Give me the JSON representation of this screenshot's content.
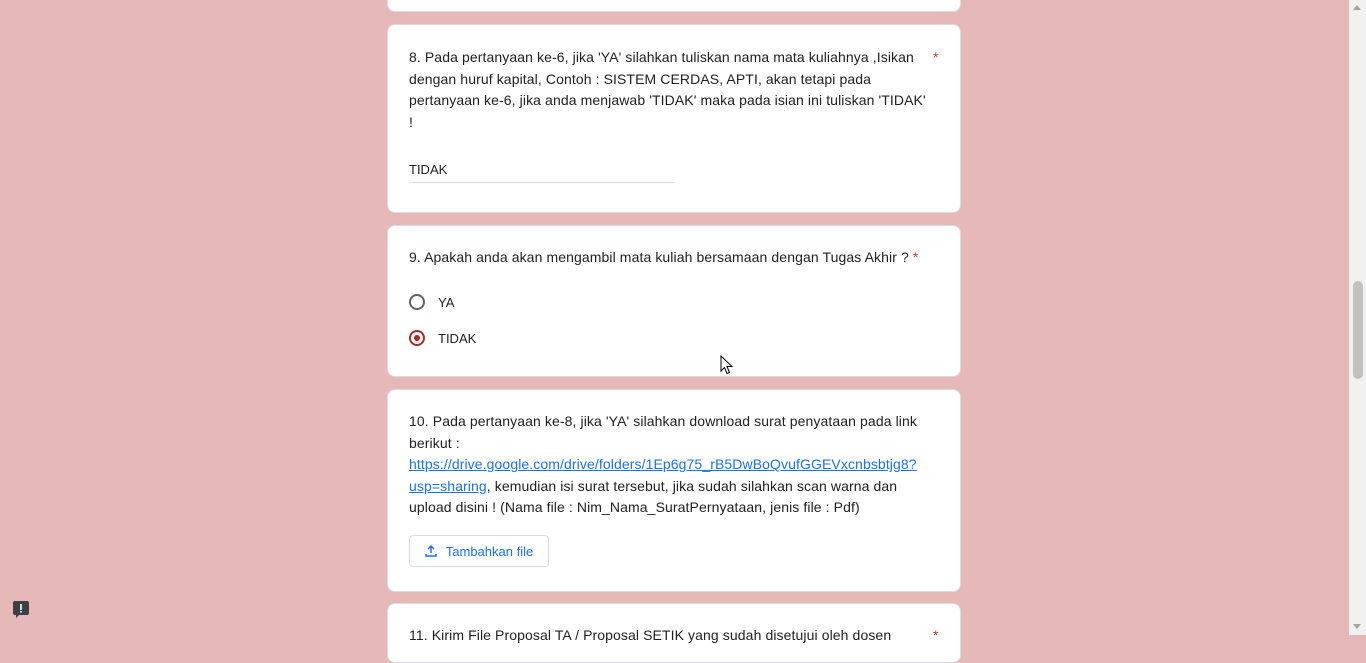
{
  "colors": {
    "background": "#e6b8b8",
    "accent": "#b3261e",
    "link": "#1a73e8",
    "required": "#d93025"
  },
  "questions": {
    "q8": {
      "text": "8. Pada pertanyaan ke-6, jika 'YA' silahkan tuliskan nama mata kuliahnya ,Isikan dengan huruf kapital, Contoh : SISTEM CERDAS, APTI, akan tetapi pada pertanyaan ke-6, jika anda menjawab 'TIDAK' maka pada isian ini tuliskan 'TIDAK' !",
      "required_mark": "*",
      "answer": "TIDAK"
    },
    "q9": {
      "text": "9. Apakah anda akan mengambil mata kuliah bersamaan dengan Tugas Akhir ?",
      "required_mark": "*",
      "options": [
        "YA",
        "TIDAK"
      ],
      "selected": "TIDAK"
    },
    "q10": {
      "text_before": "10. Pada pertanyaan ke-8, jika 'YA' silahkan download  surat penyataan pada link berikut : ",
      "link": "https://drive.google.com/drive/folders/1Ep6g75_rB5DwBoQvufGGEVxcnbsbtjg8?usp=sharing",
      "text_after": ", kemudian isi surat tersebut, jika sudah silahkan scan warna dan upload disini ! (Nama file : Nim_Nama_SuratPernyataan, jenis file : Pdf)",
      "upload_label": "Tambahkan file",
      "upload_icon": "upload-icon"
    },
    "q11": {
      "text": "11. Kirim File Proposal TA / Proposal SETIK yang sudah disetujui oleh dosen",
      "required_mark": "*"
    }
  },
  "icons": {
    "report": "report-problem-icon"
  }
}
